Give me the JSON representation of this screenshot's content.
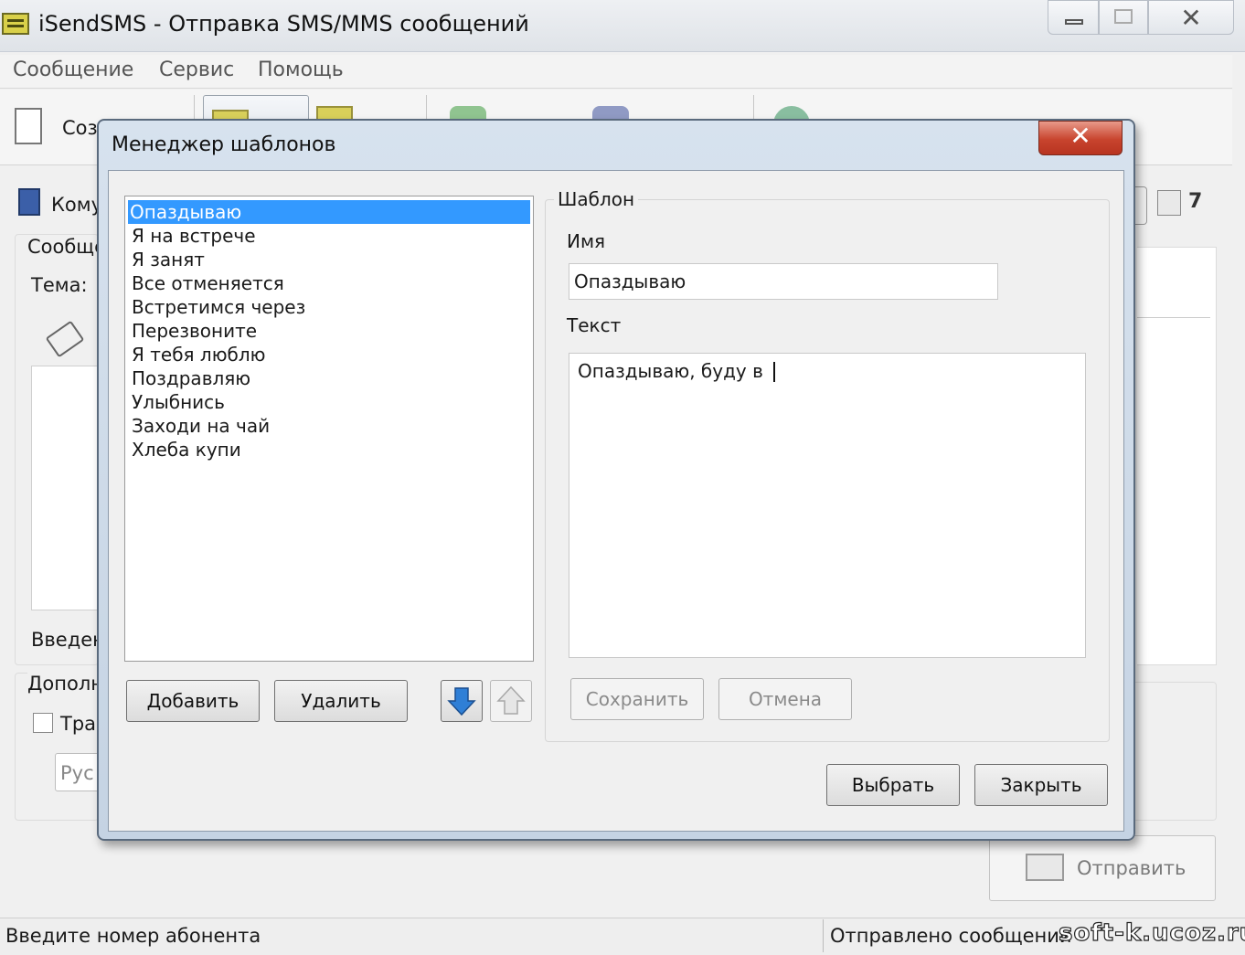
{
  "window": {
    "title": "iSendSMS - Отправка SMS/MMS сообщений",
    "minimize_glyph": "",
    "close_glyph": "✕"
  },
  "menu": {
    "items": [
      "Сообщение",
      "Сервис",
      "Помощь"
    ]
  },
  "toolbar": {
    "new_label": "Соз"
  },
  "background_form": {
    "to_label": "Кому",
    "message_group_label": "Сообще",
    "subject_label": "Тема:",
    "entered_label": "Введен",
    "extra_group_label": "Дополн",
    "translit_label": "Тра",
    "language_value": "Рус",
    "counter_value": "7",
    "send_label": "Отправить"
  },
  "status": {
    "left": "Введите номер абонента",
    "right": "Отправлено сообщений"
  },
  "watermark": "soft-k.ucoz.ru",
  "dialog": {
    "title": "Менеджер шаблонов",
    "close_glyph": "✕",
    "templates": [
      "Опаздываю",
      "Я на встрече",
      "Я занят",
      "Все отменяется",
      "Встретимся через",
      "Перезвоните",
      "Я тебя люблю",
      "Поздравляю",
      "Улыбнись",
      "Заходи на чай",
      "Хлеба купи"
    ],
    "selected_index": 0,
    "add_label": "Добавить",
    "delete_label": "Удалить",
    "group_label": "Шаблон",
    "name_label": "Имя",
    "name_value": "Опаздываю",
    "text_label": "Текст",
    "text_value": "Опаздываю, буду в",
    "save_label": "Сохранить",
    "cancel_label": "Отмена",
    "select_label": "Выбрать",
    "close_label": "Закрыть"
  },
  "colors": {
    "selection": "#3399ff",
    "dialog_close": "#c8442e",
    "arrow_down": "#2f7fd6"
  }
}
